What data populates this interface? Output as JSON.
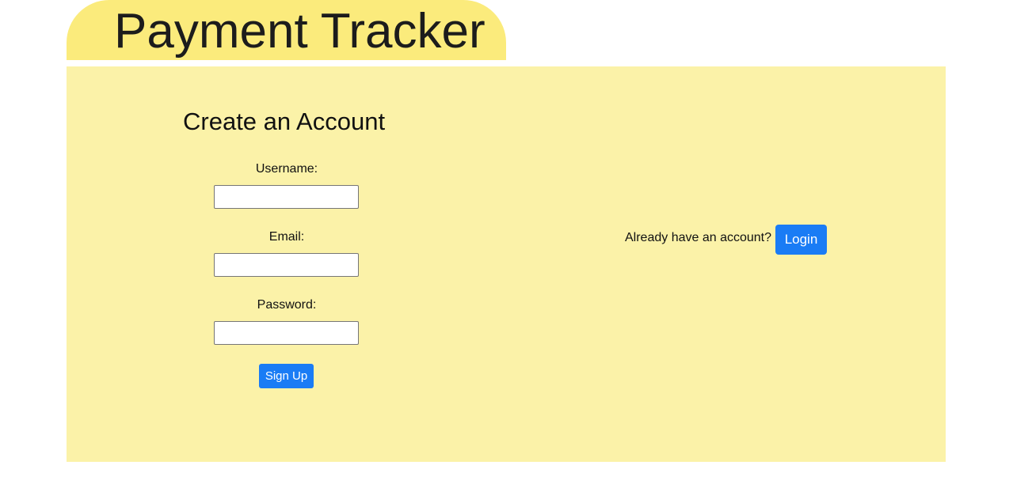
{
  "header": {
    "app_title": "Payment Tracker"
  },
  "signup": {
    "heading": "Create an Account",
    "fields": [
      {
        "label": "Username:",
        "value": "",
        "placeholder": ""
      },
      {
        "label": "Email:",
        "value": "",
        "placeholder": ""
      },
      {
        "label": "Password:",
        "value": "",
        "placeholder": ""
      }
    ],
    "submit_label": "Sign Up"
  },
  "login": {
    "prompt": "Already have an account?",
    "button_label": "Login"
  },
  "colors": {
    "title_tab_bg": "#fbeb7c",
    "panel_bg": "#fbf2a8",
    "primary_button": "#1a7cf5"
  }
}
